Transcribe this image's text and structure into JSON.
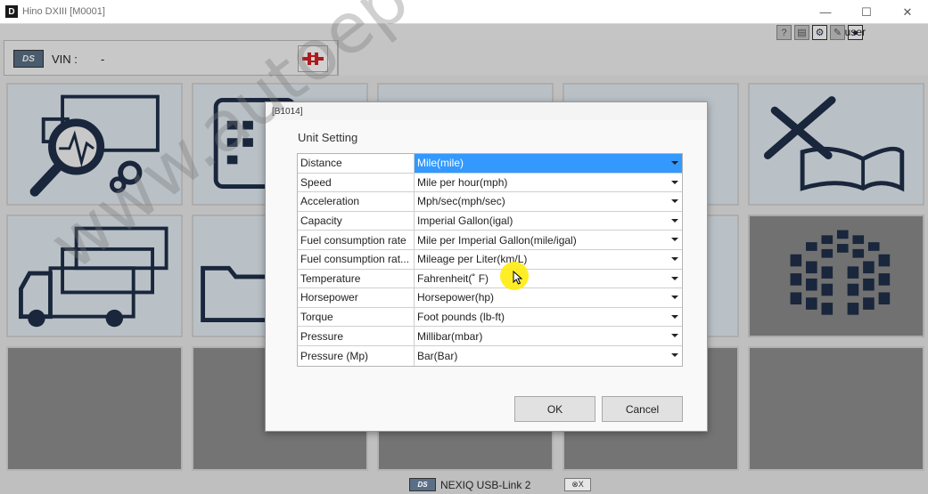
{
  "window": {
    "app_icon": "D",
    "title": "Hino DXIII [M0001]",
    "minimize": "—",
    "maximize": "☐",
    "close": "✕"
  },
  "toolbar": {
    "user_label": "user",
    "icons": [
      "help-icon",
      "print-icon",
      "gear-icon",
      "edit-icon",
      "user-icon"
    ]
  },
  "header": {
    "logo_text": "DS",
    "vin_label": "VIN :",
    "vin_value": "-"
  },
  "dialog": {
    "title": "[B1014]",
    "heading": "Unit Setting",
    "rows": [
      {
        "label": "Distance",
        "value": "Mile(mile)"
      },
      {
        "label": "Speed",
        "value": "Mile per hour(mph)"
      },
      {
        "label": "Acceleration",
        "value": "Mph/sec(mph/sec)"
      },
      {
        "label": "Capacity",
        "value": "Imperial Gallon(igal)"
      },
      {
        "label": "Fuel consumption rate",
        "value": "Mile per Imperial Gallon(mile/igal)"
      },
      {
        "label": "Fuel consumption rat...",
        "value": "Mileage per Liter(km/L)"
      },
      {
        "label": "Temperature",
        "value": "Fahrenheit(˚ F)"
      },
      {
        "label": "Horsepower",
        "value": "Horsepower(hp)"
      },
      {
        "label": "Torque",
        "value": "Foot pounds (lb-ft)"
      },
      {
        "label": "Pressure",
        "value": "Millibar(mbar)"
      },
      {
        "label": "Pressure (Mp)",
        "value": "Bar(Bar)"
      }
    ],
    "ok_label": "OK",
    "cancel_label": "Cancel"
  },
  "statusbar": {
    "logo_text": "DS",
    "adapter_text": "NEXIQ USB-Link 2",
    "icon_text": "⊗X"
  },
  "watermark": "www.autoepccatalog.com"
}
